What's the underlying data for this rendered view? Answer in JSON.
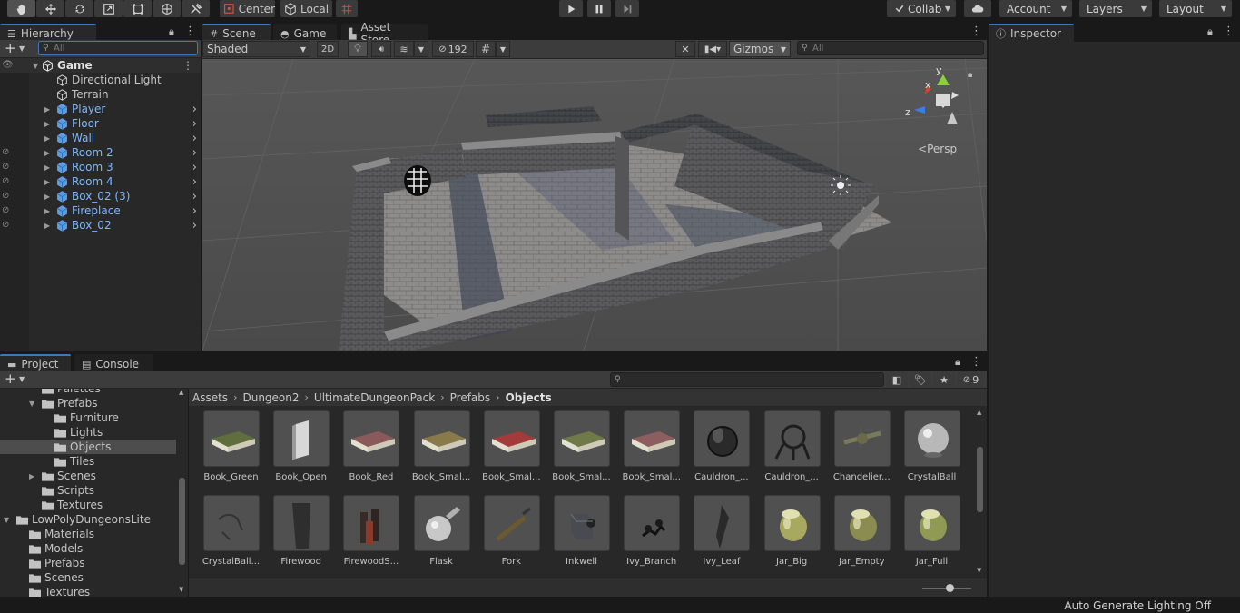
{
  "toolbar": {
    "pivot_label": "Center",
    "space_label": "Local",
    "collab_label": "Collab",
    "account_label": "Account",
    "layers_label": "Layers",
    "layout_label": "Layout"
  },
  "hierarchy": {
    "tab_label": "Hierarchy",
    "search_placeholder": "All",
    "scene_name": "Game",
    "items": [
      {
        "label": "Directional Light",
        "prefab": false,
        "hidden": false
      },
      {
        "label": "Terrain",
        "prefab": false,
        "hidden": false
      },
      {
        "label": "Player",
        "prefab": true,
        "hidden": false
      },
      {
        "label": "Floor",
        "prefab": true,
        "hidden": false
      },
      {
        "label": "Wall",
        "prefab": true,
        "hidden": false
      },
      {
        "label": "Room 2",
        "prefab": true,
        "hidden": true
      },
      {
        "label": "Room 3",
        "prefab": true,
        "hidden": true
      },
      {
        "label": "Room 4",
        "prefab": true,
        "hidden": true
      },
      {
        "label": "Box_02 (3)",
        "prefab": true,
        "hidden": true
      },
      {
        "label": "Fireplace",
        "prefab": true,
        "hidden": true
      },
      {
        "label": "Box_02",
        "prefab": true,
        "hidden": true
      }
    ]
  },
  "scene_view": {
    "tabs": [
      {
        "label": "Scene"
      },
      {
        "label": "Game"
      },
      {
        "label": "Asset Store"
      }
    ],
    "shading_mode": "Shaded",
    "mode_2d": "2D",
    "hidden_count": "192",
    "gizmos_label": "Gizmos",
    "search_placeholder": "All",
    "projection_label": "Persp",
    "axes": {
      "x": "x",
      "y": "y",
      "z": "z"
    }
  },
  "inspector": {
    "tab_label": "Inspector"
  },
  "project": {
    "tabs": [
      {
        "label": "Project"
      },
      {
        "label": "Console"
      }
    ],
    "hidden_count": "9",
    "folders": [
      {
        "label": "Palettes",
        "depth": 2,
        "expanded": null,
        "selected": false
      },
      {
        "label": "Prefabs",
        "depth": 2,
        "expanded": true,
        "selected": false
      },
      {
        "label": "Furniture",
        "depth": 3,
        "expanded": null,
        "selected": false
      },
      {
        "label": "Lights",
        "depth": 3,
        "expanded": null,
        "selected": false
      },
      {
        "label": "Objects",
        "depth": 3,
        "expanded": null,
        "selected": true
      },
      {
        "label": "Tiles",
        "depth": 3,
        "expanded": null,
        "selected": false
      },
      {
        "label": "Scenes",
        "depth": 2,
        "expanded": false,
        "selected": false
      },
      {
        "label": "Scripts",
        "depth": 2,
        "expanded": null,
        "selected": false
      },
      {
        "label": "Textures",
        "depth": 2,
        "expanded": null,
        "selected": false
      },
      {
        "label": "LowPolyDungeonsLite",
        "depth": 0,
        "expanded": true,
        "selected": false
      },
      {
        "label": "Materials",
        "depth": 1,
        "expanded": null,
        "selected": false
      },
      {
        "label": "Models",
        "depth": 1,
        "expanded": null,
        "selected": false
      },
      {
        "label": "Prefabs",
        "depth": 1,
        "expanded": null,
        "selected": false
      },
      {
        "label": "Scenes",
        "depth": 1,
        "expanded": null,
        "selected": false
      },
      {
        "label": "Textures",
        "depth": 1,
        "expanded": null,
        "selected": false
      }
    ],
    "breadcrumb": [
      "Assets",
      "Dungeon2",
      "UltimateDungeonPack",
      "Prefabs",
      "Objects"
    ],
    "assets": [
      {
        "label": "Book_Green",
        "kind": "book",
        "color": "#5f6e3c"
      },
      {
        "label": "Book_Open",
        "kind": "bookopen",
        "color": "#9a9a9a"
      },
      {
        "label": "Book_Red",
        "kind": "book",
        "color": "#8a5a5a"
      },
      {
        "label": "Book_Smal...",
        "kind": "book",
        "color": "#8a7a4a"
      },
      {
        "label": "Book_Smal...",
        "kind": "book",
        "color": "#a33b3b"
      },
      {
        "label": "Book_Smal...",
        "kind": "book",
        "color": "#6f7a48"
      },
      {
        "label": "Book_Smal...",
        "kind": "book",
        "color": "#8c5e60"
      },
      {
        "label": "Cauldron_...",
        "kind": "cauldron",
        "color": "#2a2a2a"
      },
      {
        "label": "Cauldron_...",
        "kind": "stand",
        "color": "#1e1e1e"
      },
      {
        "label": "Chandelier...",
        "kind": "chandelier",
        "color": "#7a7a5a"
      },
      {
        "label": "CrystalBall",
        "kind": "sphere",
        "color": "#b8b8b8"
      },
      {
        "label": "CrystalBall...",
        "kind": "stand2",
        "color": "#333333"
      },
      {
        "label": "Firewood",
        "kind": "log",
        "color": "#2e2e2e"
      },
      {
        "label": "FirewoodS...",
        "kind": "firewood",
        "color": "#3a2a26"
      },
      {
        "label": "Flask",
        "kind": "flask",
        "color": "#c8c8c8"
      },
      {
        "label": "Fork",
        "kind": "fork",
        "color": "#6a5a30"
      },
      {
        "label": "Inkwell",
        "kind": "inkwell",
        "color": "#4a4a52"
      },
      {
        "label": "Ivy_Branch",
        "kind": "ivy",
        "color": "#2a2a2a"
      },
      {
        "label": "Ivy_Leaf",
        "kind": "leaf",
        "color": "#2a2a2a"
      },
      {
        "label": "Jar_Big",
        "kind": "jar",
        "color": "#a8a860"
      },
      {
        "label": "Jar_Empty",
        "kind": "jar",
        "color": "#8a8c50"
      },
      {
        "label": "Jar_Full",
        "kind": "jar",
        "color": "#909a55"
      }
    ]
  },
  "status": {
    "text": "Auto Generate Lighting Off"
  },
  "colors": {
    "accent": "#3a79bb",
    "prefab_text": "#7db7ff"
  }
}
